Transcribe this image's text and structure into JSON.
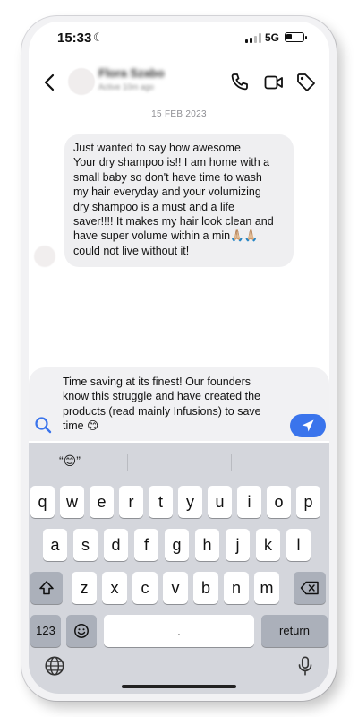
{
  "status_bar": {
    "time": "15:33",
    "network": "5G"
  },
  "header": {
    "contact_name": "Flora Szabo",
    "contact_subtitle": "Active 10m ago"
  },
  "date_separator": "15 FEB 2023",
  "messages": [
    {
      "sender": "contact",
      "text": "Just wanted to say how awesome\nYour dry shampoo is!! I am home with a\nsmall baby so don't have time to wash\nmy hair everyday and your volumizing\ndry shampoo is a must and a life\nsaver!!!! It makes my hair look clean and\nhave super volume within a min🙏🏼🙏🏼\ncould not live without it!"
    }
  ],
  "composer": {
    "text": "Time saving at its finest! Our founders\nknow this struggle and have created the\nproducts (read mainly Infusions) to save\ntime 😊"
  },
  "keyboard": {
    "suggestion": "“😊”",
    "row1": [
      "q",
      "w",
      "e",
      "r",
      "t",
      "y",
      "u",
      "i",
      "o",
      "p"
    ],
    "row2": [
      "a",
      "s",
      "d",
      "f",
      "g",
      "h",
      "j",
      "k",
      "l"
    ],
    "row3": [
      "z",
      "x",
      "c",
      "v",
      "b",
      "n",
      "m"
    ],
    "numbers_label": "123",
    "space_label": ".",
    "return_label": "return"
  },
  "colors": {
    "accent": "#3a74ec",
    "bubble": "#efeff1",
    "keyboard_bg": "#d4d6dc"
  }
}
